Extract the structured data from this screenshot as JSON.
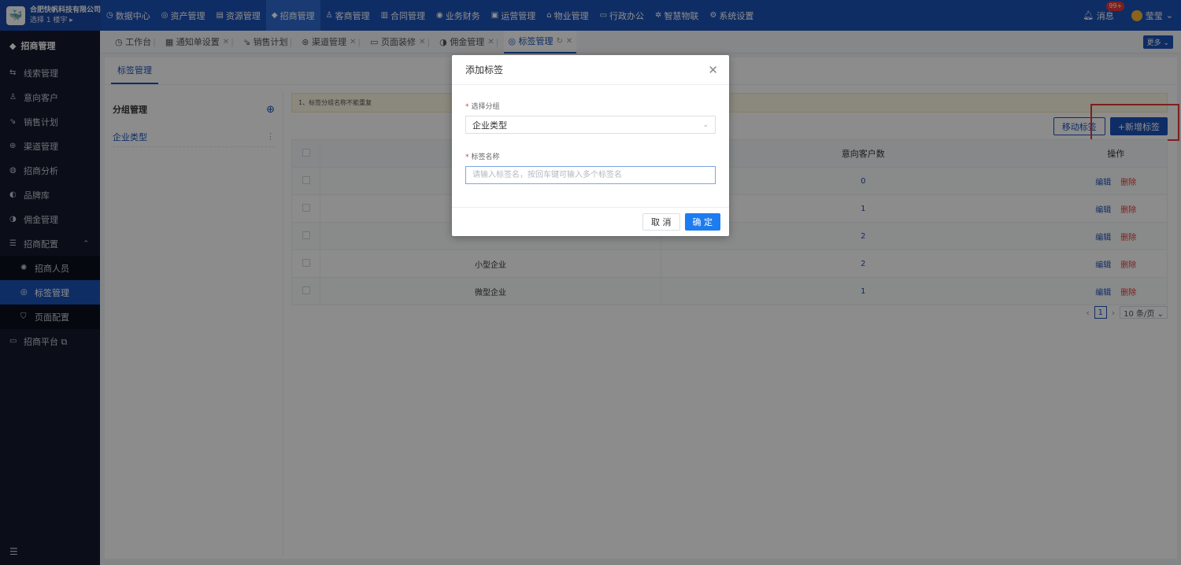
{
  "brand": {
    "name": "合肥快帆科技有限公司",
    "sub": "选择 1 楼宇 ▸",
    "logo": "🐳"
  },
  "topnav": [
    {
      "label": "数据中心",
      "icon": "◷"
    },
    {
      "label": "资产管理",
      "icon": "◎"
    },
    {
      "label": "资源管理",
      "icon": "▤"
    },
    {
      "label": "招商管理",
      "icon": "◆"
    },
    {
      "label": "客商管理",
      "icon": "♙"
    },
    {
      "label": "合同管理",
      "icon": "▥"
    },
    {
      "label": "业务财务",
      "icon": "◉"
    },
    {
      "label": "运营管理",
      "icon": "▣"
    },
    {
      "label": "物业管理",
      "icon": "⌂"
    },
    {
      "label": "行政办公",
      "icon": "▭"
    },
    {
      "label": "智慧物联",
      "icon": "✲"
    },
    {
      "label": "系统设置",
      "icon": "⚙"
    }
  ],
  "topright": {
    "messages": "消息",
    "badge": "99+",
    "user": "莹莹"
  },
  "sidebar": {
    "header": "招商管理",
    "items": [
      {
        "label": "线索管理",
        "icon": "⇆"
      },
      {
        "label": "意向客户",
        "icon": "♙"
      },
      {
        "label": "销售计划",
        "icon": "⇘"
      },
      {
        "label": "渠道管理",
        "icon": "⊛"
      },
      {
        "label": "招商分析",
        "icon": "◍"
      },
      {
        "label": "品牌库",
        "icon": "◐"
      },
      {
        "label": "佣金管理",
        "icon": "◑"
      },
      {
        "label": "招商配置",
        "icon": "☰"
      }
    ],
    "subs": [
      {
        "label": "招商人员",
        "icon": "✺"
      },
      {
        "label": "标签管理",
        "icon": "◎"
      },
      {
        "label": "页面配置",
        "icon": "⛉"
      }
    ],
    "platform": "招商平台 ⧉",
    "collapse": "☰"
  },
  "tabs": [
    {
      "label": "工作台",
      "icon": "◷"
    },
    {
      "label": "通知单设置",
      "icon": "▦"
    },
    {
      "label": "销售计划",
      "icon": "⇘"
    },
    {
      "label": "渠道管理",
      "icon": "⊛"
    },
    {
      "label": "页面装修",
      "icon": "▭"
    },
    {
      "label": "佣金管理",
      "icon": "◑"
    },
    {
      "label": "标签管理",
      "icon": "◎"
    }
  ],
  "more": "更多 ⌄",
  "subtab": "标签管理",
  "leftpanel": {
    "title": "分组管理",
    "plus": "⊕",
    "group": "企业类型",
    "dots": "⋮"
  },
  "notice": "1、标签分组名称不能重复",
  "buttons": {
    "move": "移动标签",
    "add": "+新增标签"
  },
  "table": {
    "headers": {
      "customers": "意向客户数",
      "actions": "操作"
    },
    "edit": "编辑",
    "delete": "删除",
    "rows": [
      {
        "name": "",
        "count": "0"
      },
      {
        "name": "",
        "count": "1"
      },
      {
        "name": "",
        "count": "2"
      },
      {
        "name": "小型企业",
        "count": "2"
      },
      {
        "name": "微型企业",
        "count": "1"
      }
    ]
  },
  "pager": {
    "prev": "‹",
    "page": "1",
    "next": "›",
    "size": "10 条/页 ⌄"
  },
  "modal": {
    "title": "添加标签",
    "close": "✕",
    "group_label": "选择分组",
    "group_value": "企业类型",
    "name_label": "标签名称",
    "name_placeholder": "请输入标签名，按回车键可输入多个标签名",
    "required_mark": "*",
    "cancel": "取 消",
    "ok": "确 定"
  }
}
